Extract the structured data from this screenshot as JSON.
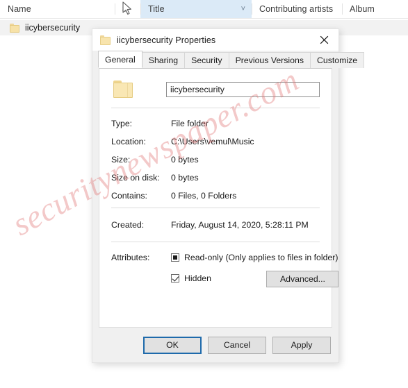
{
  "explorer": {
    "columns": [
      {
        "id": "name",
        "label": "Name"
      },
      {
        "id": "number",
        "label": "#"
      },
      {
        "id": "title",
        "label": "Title"
      },
      {
        "id": "artists",
        "label": "Contributing artists"
      },
      {
        "id": "album",
        "label": "Album"
      }
    ],
    "sort_indicator": "˅",
    "rows": [
      {
        "name": "iicybersecurity",
        "icon": "folder-icon"
      }
    ]
  },
  "watermark": {
    "text": "securitynewspaper.com"
  },
  "dialog": {
    "title": "iicybersecurity Properties",
    "icon": "folder-icon",
    "close_label": "✕",
    "tabs": [
      {
        "label": "General",
        "active": true
      },
      {
        "label": "Sharing",
        "active": false
      },
      {
        "label": "Security",
        "active": false
      },
      {
        "label": "Previous Versions",
        "active": false
      },
      {
        "label": "Customize",
        "active": false
      }
    ],
    "name_field": {
      "value": "iicybersecurity",
      "placeholder": ""
    },
    "info": [
      {
        "label": "Type:",
        "value": "File folder"
      },
      {
        "label": "Location:",
        "value": "C:\\Users\\vemul\\Music"
      },
      {
        "label": "Size:",
        "value": "0 bytes"
      },
      {
        "label": "Size on disk:",
        "value": "0 bytes"
      },
      {
        "label": "Contains:",
        "value": "0 Files, 0 Folders"
      }
    ],
    "created": {
      "label": "Created:",
      "value": "Friday, August 14, 2020, 5:28:11 PM"
    },
    "attributes": {
      "label": "Attributes:",
      "readonly": {
        "label": "Read-only (Only applies to files in folder)",
        "state": "indeterminate"
      },
      "hidden": {
        "label": "Hidden",
        "state": "checked"
      },
      "advanced_label": "Advanced..."
    },
    "buttons": {
      "ok": "OK",
      "cancel": "Cancel",
      "apply": "Apply"
    }
  },
  "colors": {
    "accent": "#1e6aab",
    "column_highlight": "#dbeaf7",
    "folder": "#f9e7b4",
    "watermark": "#e27878"
  }
}
